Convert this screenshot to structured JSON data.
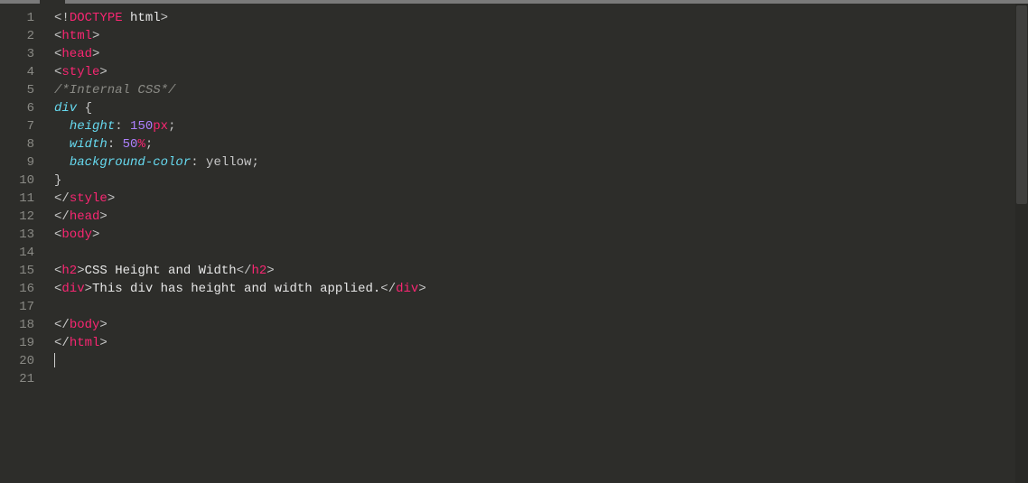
{
  "editor": {
    "line_count": 21,
    "cursor_line": 20,
    "lines": {
      "l1": [
        [
          "p",
          "<!"
        ],
        [
          "tg",
          "DOCTYPE"
        ],
        [
          "tx",
          " html"
        ],
        [
          "p",
          ">"
        ]
      ],
      "l2": [
        [
          "p",
          "<"
        ],
        [
          "tg",
          "html"
        ],
        [
          "p",
          ">"
        ]
      ],
      "l3": [
        [
          "p",
          "<"
        ],
        [
          "tg",
          "head"
        ],
        [
          "p",
          ">"
        ]
      ],
      "l4": [
        [
          "p",
          "<"
        ],
        [
          "tg",
          "style"
        ],
        [
          "p",
          ">"
        ]
      ],
      "l5": [
        [
          "cm",
          "/*Internal CSS*/"
        ]
      ],
      "l6": [
        [
          "kw",
          "div"
        ],
        [
          "p",
          " {"
        ]
      ],
      "l7": [
        [
          "p",
          "  "
        ],
        [
          "kw",
          "height"
        ],
        [
          "p",
          ": "
        ],
        [
          "nm",
          "150"
        ],
        [
          "un",
          "px"
        ],
        [
          "p",
          ";"
        ]
      ],
      "l8": [
        [
          "p",
          "  "
        ],
        [
          "kw",
          "width"
        ],
        [
          "p",
          ": "
        ],
        [
          "nm",
          "50"
        ],
        [
          "un",
          "%"
        ],
        [
          "p",
          ";"
        ]
      ],
      "l9": [
        [
          "p",
          "  "
        ],
        [
          "kw",
          "background-color"
        ],
        [
          "p",
          ": "
        ],
        [
          "vl",
          "yellow"
        ],
        [
          "p",
          ";"
        ]
      ],
      "l10": [
        [
          "p",
          "}"
        ]
      ],
      "l11": [
        [
          "p",
          "</"
        ],
        [
          "tg",
          "style"
        ],
        [
          "p",
          ">"
        ]
      ],
      "l12": [
        [
          "p",
          "</"
        ],
        [
          "tg",
          "head"
        ],
        [
          "p",
          ">"
        ]
      ],
      "l13": [
        [
          "p",
          "<"
        ],
        [
          "tg",
          "body"
        ],
        [
          "p",
          ">"
        ]
      ],
      "l14": [
        [
          "p",
          ""
        ]
      ],
      "l15": [
        [
          "p",
          "<"
        ],
        [
          "tg",
          "h2"
        ],
        [
          "p",
          ">"
        ],
        [
          "tx",
          "CSS Height and Width"
        ],
        [
          "p",
          "</"
        ],
        [
          "tg",
          "h2"
        ],
        [
          "p",
          ">"
        ]
      ],
      "l16": [
        [
          "p",
          "<"
        ],
        [
          "tg",
          "div"
        ],
        [
          "p",
          ">"
        ],
        [
          "tx",
          "This div has height and width applied."
        ],
        [
          "p",
          "</"
        ],
        [
          "tg",
          "div"
        ],
        [
          "p",
          ">"
        ]
      ],
      "l17": [
        [
          "p",
          ""
        ]
      ],
      "l18": [
        [
          "p",
          "</"
        ],
        [
          "tg",
          "body"
        ],
        [
          "p",
          ">"
        ]
      ],
      "l19": [
        [
          "p",
          "</"
        ],
        [
          "tg",
          "html"
        ],
        [
          "p",
          ">"
        ]
      ],
      "l20": [
        [
          "p",
          ""
        ]
      ],
      "l21": [
        [
          "p",
          ""
        ]
      ]
    }
  }
}
